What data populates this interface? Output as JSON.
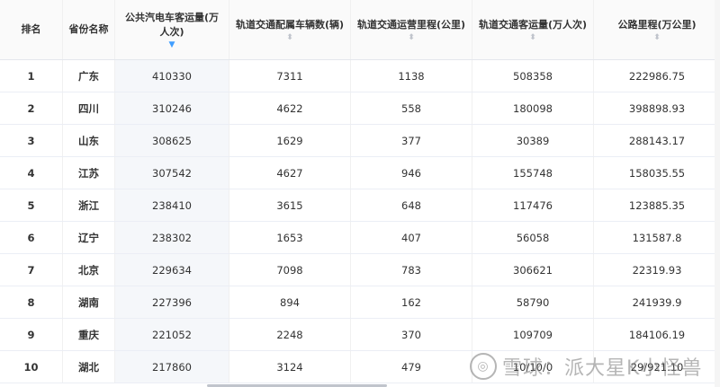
{
  "header": {
    "rank": "排名",
    "province": "省份名称",
    "bus": "公共汽电车客运量(万人次)",
    "rail_vehicles": "轨道交通配属车辆数(辆)",
    "rail_mileage": "轨道交通运营里程(公里)",
    "rail_passengers": "轨道交通客运量(万人次)",
    "road_mileage": "公路里程(万公里)"
  },
  "rows": [
    {
      "rank": "1",
      "province": "广东",
      "bus": "410330",
      "rail_vehicles": "7311",
      "rail_mileage": "1138",
      "rail_passengers": "508358",
      "road_mileage": "222986.75"
    },
    {
      "rank": "2",
      "province": "四川",
      "bus": "310246",
      "rail_vehicles": "4622",
      "rail_mileage": "558",
      "rail_passengers": "180098",
      "road_mileage": "398898.93"
    },
    {
      "rank": "3",
      "province": "山东",
      "bus": "308625",
      "rail_vehicles": "1629",
      "rail_mileage": "377",
      "rail_passengers": "30389",
      "road_mileage": "288143.17"
    },
    {
      "rank": "4",
      "province": "江苏",
      "bus": "307542",
      "rail_vehicles": "4627",
      "rail_mileage": "946",
      "rail_passengers": "155748",
      "road_mileage": "158035.55"
    },
    {
      "rank": "5",
      "province": "浙江",
      "bus": "238410",
      "rail_vehicles": "3615",
      "rail_mileage": "648",
      "rail_passengers": "117476",
      "road_mileage": "123885.35"
    },
    {
      "rank": "6",
      "province": "辽宁",
      "bus": "238302",
      "rail_vehicles": "1653",
      "rail_mileage": "407",
      "rail_passengers": "56058",
      "road_mileage": "131587.8"
    },
    {
      "rank": "7",
      "province": "北京",
      "bus": "229634",
      "rail_vehicles": "7098",
      "rail_mileage": "783",
      "rail_passengers": "306621",
      "road_mileage": "22319.93"
    },
    {
      "rank": "8",
      "province": "湖南",
      "bus": "227396",
      "rail_vehicles": "894",
      "rail_mileage": "162",
      "rail_passengers": "58790",
      "road_mileage": "241939.9"
    },
    {
      "rank": "9",
      "province": "重庆",
      "bus": "221052",
      "rail_vehicles": "2248",
      "rail_mileage": "370",
      "rail_passengers": "109709",
      "road_mileage": "184106.19"
    },
    {
      "rank": "10",
      "province": "湖北",
      "bus": "217860",
      "rail_vehicles": "3124",
      "rail_mileage": "479",
      "rail_passengers": "10/10/0",
      "road_mileage": "29/921.10"
    }
  ],
  "watermark": "雪球：派大星K小怪兽",
  "sort_icon": "sort-caret-icon",
  "colors": {
    "active_sort": "#409eff",
    "header_bg": "#fafafa",
    "sorted_col_bg": "#f5f7fa"
  }
}
